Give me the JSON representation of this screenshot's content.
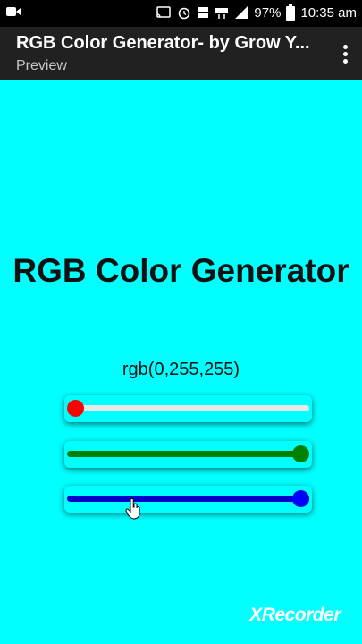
{
  "status_bar": {
    "battery": "97%",
    "time": "10:35 am",
    "icons": [
      "screen-record-icon",
      "cast-icon",
      "alarm-icon",
      "volte-icon",
      "lte-icon",
      "signal-icon",
      "battery-icon"
    ]
  },
  "app_bar": {
    "title": "RGB Color Generator- by Grow Y...",
    "subtitle": "Preview"
  },
  "content": {
    "heading": "RGB Color Generator",
    "rgb_value": "rgb(0,255,255)",
    "background_color": "#00ffff"
  },
  "sliders": [
    {
      "name": "red",
      "value": 0,
      "max": 255,
      "color": "#ff0000",
      "track_color": "#e8e8e8"
    },
    {
      "name": "green",
      "value": 255,
      "max": 255,
      "color": "#008000",
      "track_color": "#008000"
    },
    {
      "name": "blue",
      "value": 255,
      "max": 255,
      "color": "#0000ff",
      "track_color": "#0000cc"
    }
  ],
  "watermark": "XRecorder"
}
